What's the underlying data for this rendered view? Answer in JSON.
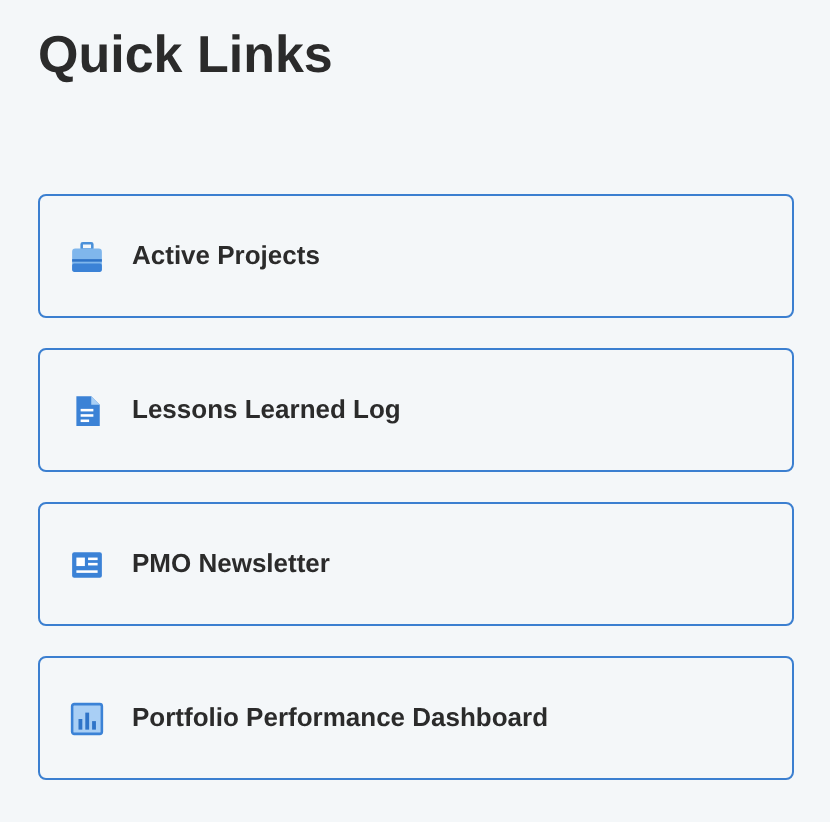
{
  "title": "Quick Links",
  "links": [
    {
      "label": "Active Projects",
      "kind": "briefcase"
    },
    {
      "label": "Lessons Learned Log",
      "kind": "document"
    },
    {
      "label": "PMO Newsletter",
      "kind": "newsletter"
    },
    {
      "label": "Portfolio Performance Dashboard",
      "kind": "chart"
    }
  ]
}
